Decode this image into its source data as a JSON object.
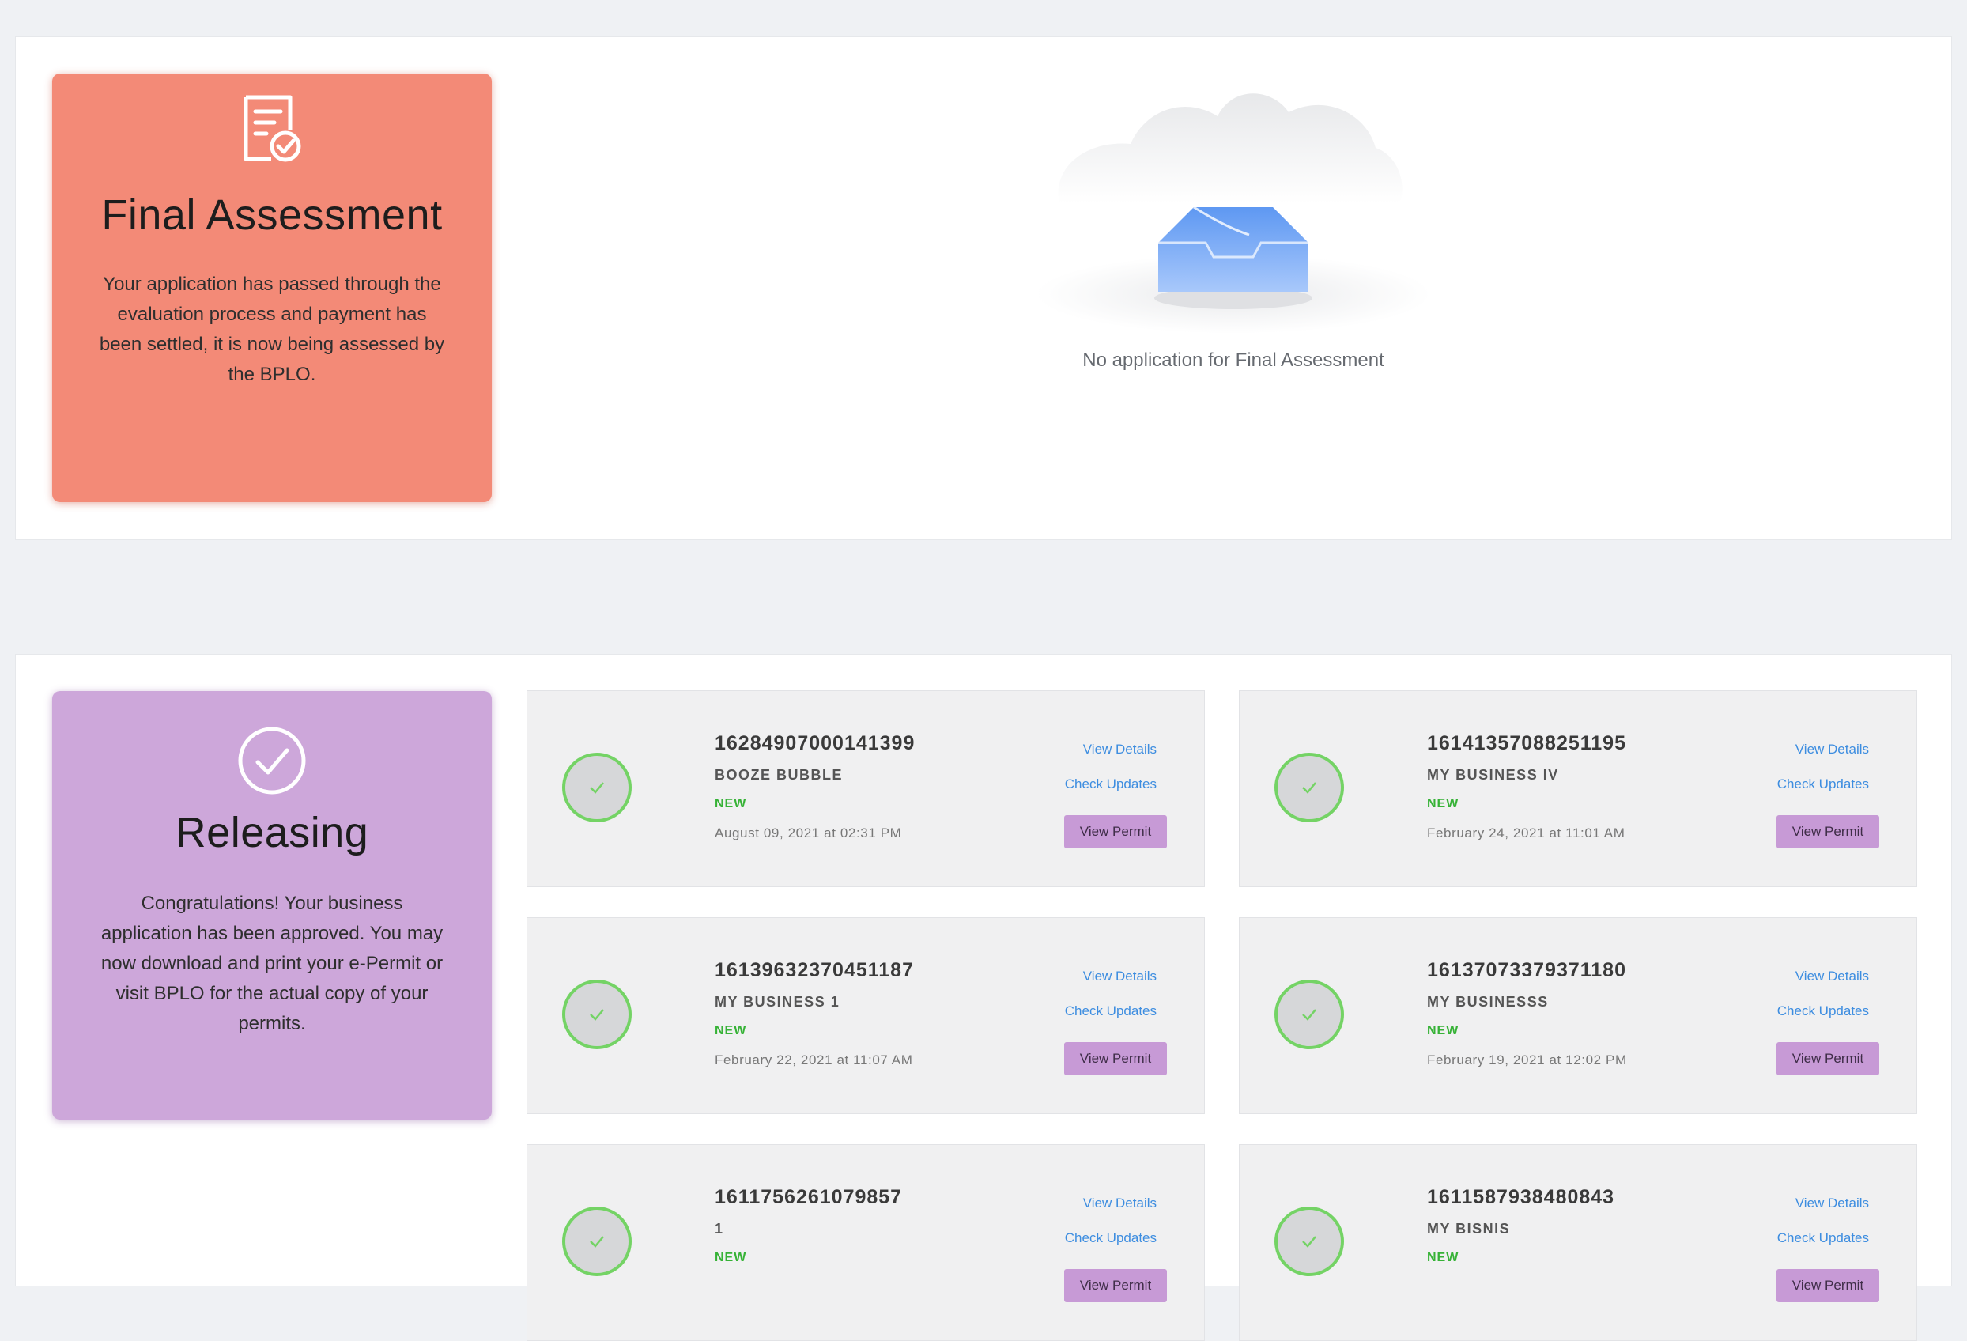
{
  "final_assessment": {
    "title": "Final Assessment",
    "description": "Your application has passed through the evaluation process and payment has been settled, it is now being assessed by the BPLO.",
    "empty_message": "No application for Final Assessment"
  },
  "releasing": {
    "title": "Releasing",
    "description": "Congratulations! Your business application has been approved. You may now download and print your e-Permit or visit BPLO for the actual copy of your permits.",
    "applications": [
      {
        "id": "16284907000141399",
        "name": "BOOZE BUBBLE",
        "status": "NEW",
        "date": "August 09, 2021 at 02:31 PM",
        "view_details": "View Details",
        "check_updates": "Check Updates",
        "view_permit": "View Permit"
      },
      {
        "id": "16141357088251195",
        "name": "MY BUSINESS IV",
        "status": "NEW",
        "date": "February 24, 2021 at 11:01 AM",
        "view_details": "View Details",
        "check_updates": "Check Updates",
        "view_permit": "View Permit"
      },
      {
        "id": "16139632370451187",
        "name": "MY BUSINESS 1",
        "status": "NEW",
        "date": "February 22, 2021 at 11:07 AM",
        "view_details": "View Details",
        "check_updates": "Check Updates",
        "view_permit": "View Permit"
      },
      {
        "id": "16137073379371180",
        "name": "MY BUSINESSS",
        "status": "NEW",
        "date": "February 19, 2021 at 12:02 PM",
        "view_details": "View Details",
        "check_updates": "Check Updates",
        "view_permit": "View Permit"
      },
      {
        "id": "1611756261079857",
        "name": "1",
        "status": "NEW",
        "date": "",
        "view_details": "View Details",
        "check_updates": "Check Updates",
        "view_permit": "View Permit"
      },
      {
        "id": "1611587938480843",
        "name": "MY BISNIS",
        "status": "NEW",
        "date": "",
        "view_details": "View Details",
        "check_updates": "Check Updates",
        "view_permit": "View Permit"
      }
    ]
  },
  "colors": {
    "final_card": "#f38a77",
    "releasing_card": "#cda7da",
    "link": "#3d8de0",
    "status_new": "#36b236",
    "permit_button": "#c79ad6",
    "check_ring": "#74d365"
  },
  "icons": [
    "document-check-icon",
    "empty-inbox-icon",
    "circle-check-icon",
    "check-icon"
  ]
}
